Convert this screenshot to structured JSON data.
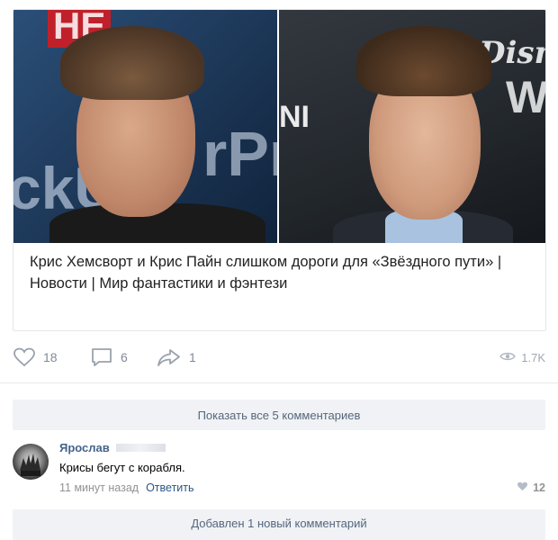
{
  "post": {
    "photos": {
      "left_sign_top": "HE",
      "left_sign_text": "ckU",
      "left_sign_text2": "rPr",
      "right_sign_text": "NI",
      "right_brand": "Disne",
      "right_brand2": "W"
    },
    "headline": "Крис Хемсворт и Крис Пайн слишком дороги для «Звёздного пути» | Новости | Мир фантастики и фэнтези",
    "likes": "18",
    "comments": "6",
    "shares": "1",
    "views": "1.7K"
  },
  "comments_section": {
    "show_all_label": "Показать все 5 комментариев",
    "comment": {
      "author": "Ярослав",
      "text": "Крисы бегут с корабля.",
      "time": "11 минут назад",
      "reply_label": "Ответить",
      "likes": "12"
    },
    "new_comment_label": "Добавлен 1 новый комментарий"
  },
  "colors": {
    "link": "#2a5885",
    "muted": "#828a99",
    "button_bg": "#f0f2f5"
  }
}
